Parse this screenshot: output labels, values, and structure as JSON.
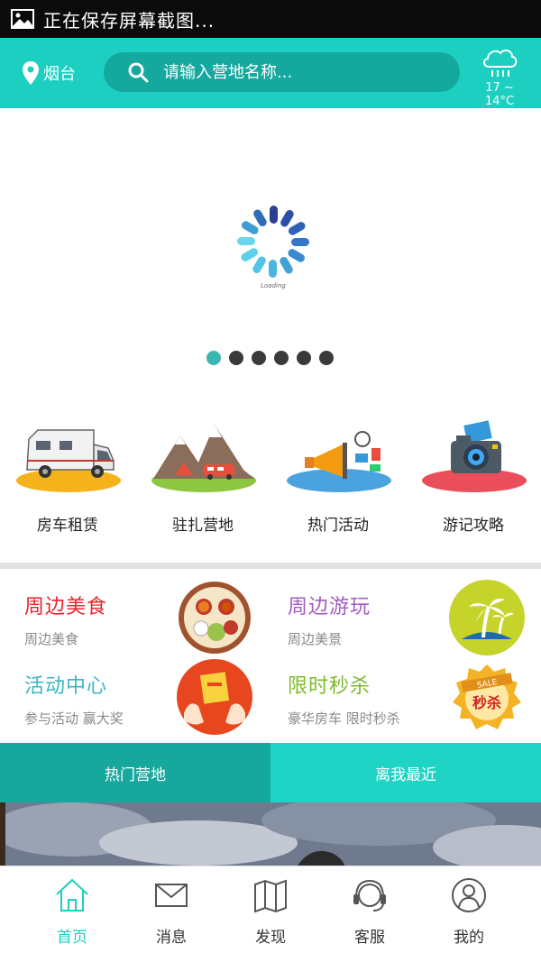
{
  "status_bar": {
    "text": "正在保存屏幕截图...",
    "icon": "image-icon"
  },
  "header": {
    "location": "烟台",
    "location_icon": "location-pin-icon",
    "search_placeholder": "请输入营地名称...",
    "search_icon": "search-icon",
    "weather_icon": "rain-cloud-icon",
    "temperature": "17 ~ 14°C"
  },
  "banner": {
    "loading_text": "Loading",
    "dot_count": 6,
    "active_dot": 0
  },
  "categories": [
    {
      "label": "房车租赁",
      "icon": "rv-icon"
    },
    {
      "label": "驻扎营地",
      "icon": "campsite-icon"
    },
    {
      "label": "热门活动",
      "icon": "megaphone-icon"
    },
    {
      "label": "游记攻略",
      "icon": "camera-icon"
    }
  ],
  "promos": [
    {
      "title": "周边美食",
      "subtitle": "周边美食",
      "color": "#e8232b",
      "icon": "food-plate-icon"
    },
    {
      "title": "周边游玩",
      "subtitle": "周边美景",
      "color": "#a35bc1",
      "icon": "palm-tree-icon"
    },
    {
      "title": "活动中心",
      "subtitle": "参与活动 赢大奖",
      "color": "#39b7c2",
      "icon": "red-envelope-icon"
    },
    {
      "title": "限时秒杀",
      "subtitle": "豪华房车 限时秒杀",
      "color": "#7dbb2c",
      "icon": "sale-badge-icon"
    }
  ],
  "sale_badge": {
    "top": "SALE",
    "main": "秒杀"
  },
  "tabs": [
    {
      "label": "热门营地",
      "active": true
    },
    {
      "label": "离我最近",
      "active": false
    }
  ],
  "nav": [
    {
      "label": "首页",
      "icon": "home-icon",
      "active": true
    },
    {
      "label": "消息",
      "icon": "mail-icon",
      "active": false
    },
    {
      "label": "发现",
      "icon": "map-icon",
      "active": false
    },
    {
      "label": "客服",
      "icon": "headset-icon",
      "active": false
    },
    {
      "label": "我的",
      "icon": "user-icon",
      "active": false
    }
  ],
  "colors": {
    "accent": "#1ccfc0",
    "accent_dark": "#16a89d",
    "dot_active": "#3ab7b0"
  }
}
